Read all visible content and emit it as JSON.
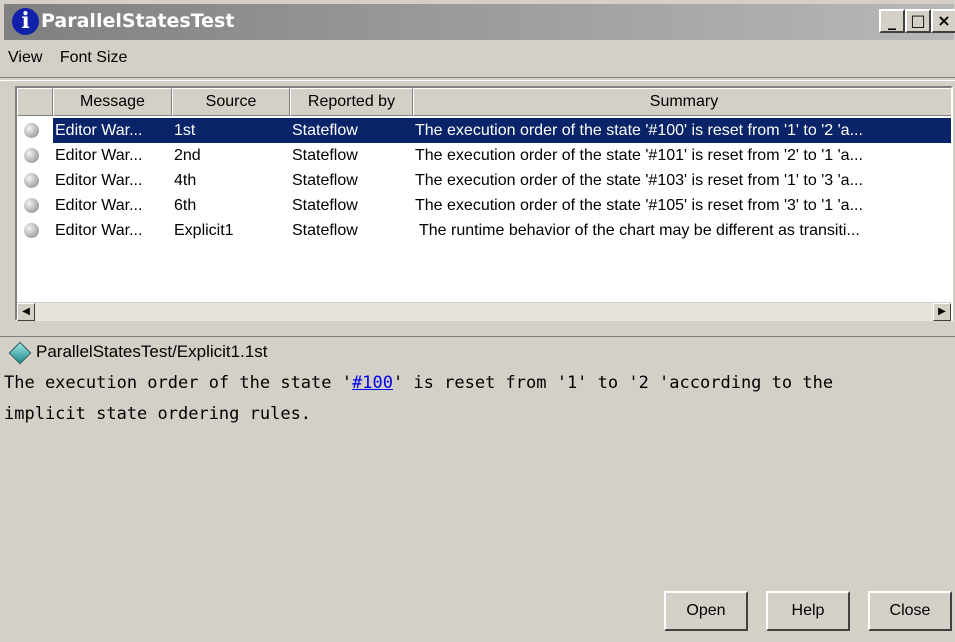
{
  "window": {
    "title": "ParallelStatesTest",
    "title_icon": "info-icon",
    "controls": {
      "minimize": "_",
      "maximize": "□",
      "close": "×"
    }
  },
  "menu": [
    "View",
    "Font Size"
  ],
  "table": {
    "columns": [
      "",
      "Message",
      "Source",
      "Reported by",
      "Summary"
    ],
    "rows": [
      {
        "icon": "warning-dot-icon",
        "message": "Editor War...",
        "source": "1st",
        "reported_by": "Stateflow",
        "summary": "The execution order of the state '#100' is reset from '1' to '2 'a...",
        "selected": true
      },
      {
        "icon": "warning-dot-icon",
        "message": "Editor War...",
        "source": "2nd",
        "reported_by": "Stateflow",
        "summary": "The execution order of the state '#101' is reset from '2' to '1 'a...",
        "selected": false
      },
      {
        "icon": "warning-dot-icon",
        "message": "Editor War...",
        "source": "4th",
        "reported_by": "Stateflow",
        "summary": "The execution order of the state '#103' is reset from '1' to '3 'a...",
        "selected": false
      },
      {
        "icon": "warning-dot-icon",
        "message": "Editor War...",
        "source": "6th",
        "reported_by": "Stateflow",
        "summary": "The execution order of the state '#105' is reset from '3' to '1 'a...",
        "selected": false
      },
      {
        "icon": "warning-dot-icon",
        "message": "Editor War...",
        "source": "Explicit1",
        "reported_by": "Stateflow",
        "summary": "The runtime behavior of the chart may be different as transiti...",
        "selected": false
      }
    ]
  },
  "details": {
    "path": "ParallelStatesTest/Explicit1.1st",
    "line1_prefix": "The execution order of the state '",
    "link": "#100",
    "line1_suffix": "' is reset from '1' to '2 'according to the",
    "line2": "implicit state ordering rules."
  },
  "buttons": {
    "open": "Open",
    "help": "Help",
    "close": "Close"
  },
  "colors": {
    "selection": "#0a246a",
    "link": "#0000ee",
    "title_gradient_start": "#808080"
  }
}
